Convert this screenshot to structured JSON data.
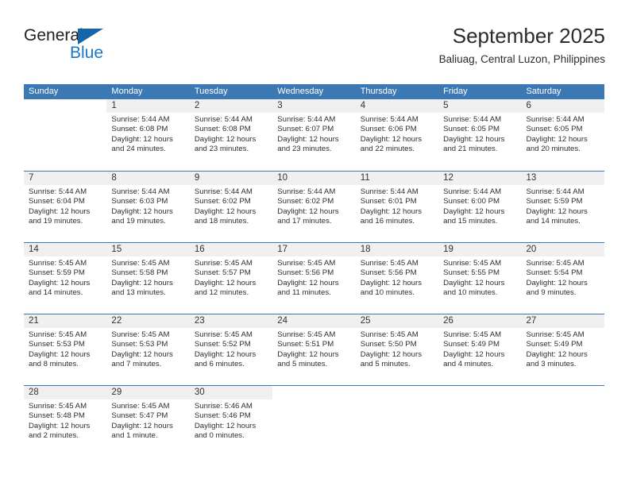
{
  "brand": {
    "name_top": "General",
    "name_bottom": "Blue",
    "triangle_icon": "triangle-icon",
    "color_dark": "#231f20",
    "color_blue": "#1878c8"
  },
  "header": {
    "title": "September 2025",
    "subtitle": "Baliuag, Central Luzon, Philippines"
  },
  "theme": {
    "header_bar": "#3c78b4",
    "daynum_band": "#f0f0f0",
    "row_rule": "#3c78b4",
    "text": "#2e2e2e"
  },
  "weekdays": [
    "Sunday",
    "Monday",
    "Tuesday",
    "Wednesday",
    "Thursday",
    "Friday",
    "Saturday"
  ],
  "weeks": [
    [
      {
        "day": "",
        "sunrise": "",
        "sunset": "",
        "daylight_a": "",
        "daylight_b": ""
      },
      {
        "day": "1",
        "sunrise": "Sunrise: 5:44 AM",
        "sunset": "Sunset: 6:08 PM",
        "daylight_a": "Daylight: 12 hours",
        "daylight_b": "and 24 minutes."
      },
      {
        "day": "2",
        "sunrise": "Sunrise: 5:44 AM",
        "sunset": "Sunset: 6:08 PM",
        "daylight_a": "Daylight: 12 hours",
        "daylight_b": "and 23 minutes."
      },
      {
        "day": "3",
        "sunrise": "Sunrise: 5:44 AM",
        "sunset": "Sunset: 6:07 PM",
        "daylight_a": "Daylight: 12 hours",
        "daylight_b": "and 23 minutes."
      },
      {
        "day": "4",
        "sunrise": "Sunrise: 5:44 AM",
        "sunset": "Sunset: 6:06 PM",
        "daylight_a": "Daylight: 12 hours",
        "daylight_b": "and 22 minutes."
      },
      {
        "day": "5",
        "sunrise": "Sunrise: 5:44 AM",
        "sunset": "Sunset: 6:05 PM",
        "daylight_a": "Daylight: 12 hours",
        "daylight_b": "and 21 minutes."
      },
      {
        "day": "6",
        "sunrise": "Sunrise: 5:44 AM",
        "sunset": "Sunset: 6:05 PM",
        "daylight_a": "Daylight: 12 hours",
        "daylight_b": "and 20 minutes."
      }
    ],
    [
      {
        "day": "7",
        "sunrise": "Sunrise: 5:44 AM",
        "sunset": "Sunset: 6:04 PM",
        "daylight_a": "Daylight: 12 hours",
        "daylight_b": "and 19 minutes."
      },
      {
        "day": "8",
        "sunrise": "Sunrise: 5:44 AM",
        "sunset": "Sunset: 6:03 PM",
        "daylight_a": "Daylight: 12 hours",
        "daylight_b": "and 19 minutes."
      },
      {
        "day": "9",
        "sunrise": "Sunrise: 5:44 AM",
        "sunset": "Sunset: 6:02 PM",
        "daylight_a": "Daylight: 12 hours",
        "daylight_b": "and 18 minutes."
      },
      {
        "day": "10",
        "sunrise": "Sunrise: 5:44 AM",
        "sunset": "Sunset: 6:02 PM",
        "daylight_a": "Daylight: 12 hours",
        "daylight_b": "and 17 minutes."
      },
      {
        "day": "11",
        "sunrise": "Sunrise: 5:44 AM",
        "sunset": "Sunset: 6:01 PM",
        "daylight_a": "Daylight: 12 hours",
        "daylight_b": "and 16 minutes."
      },
      {
        "day": "12",
        "sunrise": "Sunrise: 5:44 AM",
        "sunset": "Sunset: 6:00 PM",
        "daylight_a": "Daylight: 12 hours",
        "daylight_b": "and 15 minutes."
      },
      {
        "day": "13",
        "sunrise": "Sunrise: 5:44 AM",
        "sunset": "Sunset: 5:59 PM",
        "daylight_a": "Daylight: 12 hours",
        "daylight_b": "and 14 minutes."
      }
    ],
    [
      {
        "day": "14",
        "sunrise": "Sunrise: 5:45 AM",
        "sunset": "Sunset: 5:59 PM",
        "daylight_a": "Daylight: 12 hours",
        "daylight_b": "and 14 minutes."
      },
      {
        "day": "15",
        "sunrise": "Sunrise: 5:45 AM",
        "sunset": "Sunset: 5:58 PM",
        "daylight_a": "Daylight: 12 hours",
        "daylight_b": "and 13 minutes."
      },
      {
        "day": "16",
        "sunrise": "Sunrise: 5:45 AM",
        "sunset": "Sunset: 5:57 PM",
        "daylight_a": "Daylight: 12 hours",
        "daylight_b": "and 12 minutes."
      },
      {
        "day": "17",
        "sunrise": "Sunrise: 5:45 AM",
        "sunset": "Sunset: 5:56 PM",
        "daylight_a": "Daylight: 12 hours",
        "daylight_b": "and 11 minutes."
      },
      {
        "day": "18",
        "sunrise": "Sunrise: 5:45 AM",
        "sunset": "Sunset: 5:56 PM",
        "daylight_a": "Daylight: 12 hours",
        "daylight_b": "and 10 minutes."
      },
      {
        "day": "19",
        "sunrise": "Sunrise: 5:45 AM",
        "sunset": "Sunset: 5:55 PM",
        "daylight_a": "Daylight: 12 hours",
        "daylight_b": "and 10 minutes."
      },
      {
        "day": "20",
        "sunrise": "Sunrise: 5:45 AM",
        "sunset": "Sunset: 5:54 PM",
        "daylight_a": "Daylight: 12 hours",
        "daylight_b": "and 9 minutes."
      }
    ],
    [
      {
        "day": "21",
        "sunrise": "Sunrise: 5:45 AM",
        "sunset": "Sunset: 5:53 PM",
        "daylight_a": "Daylight: 12 hours",
        "daylight_b": "and 8 minutes."
      },
      {
        "day": "22",
        "sunrise": "Sunrise: 5:45 AM",
        "sunset": "Sunset: 5:53 PM",
        "daylight_a": "Daylight: 12 hours",
        "daylight_b": "and 7 minutes."
      },
      {
        "day": "23",
        "sunrise": "Sunrise: 5:45 AM",
        "sunset": "Sunset: 5:52 PM",
        "daylight_a": "Daylight: 12 hours",
        "daylight_b": "and 6 minutes."
      },
      {
        "day": "24",
        "sunrise": "Sunrise: 5:45 AM",
        "sunset": "Sunset: 5:51 PM",
        "daylight_a": "Daylight: 12 hours",
        "daylight_b": "and 5 minutes."
      },
      {
        "day": "25",
        "sunrise": "Sunrise: 5:45 AM",
        "sunset": "Sunset: 5:50 PM",
        "daylight_a": "Daylight: 12 hours",
        "daylight_b": "and 5 minutes."
      },
      {
        "day": "26",
        "sunrise": "Sunrise: 5:45 AM",
        "sunset": "Sunset: 5:49 PM",
        "daylight_a": "Daylight: 12 hours",
        "daylight_b": "and 4 minutes."
      },
      {
        "day": "27",
        "sunrise": "Sunrise: 5:45 AM",
        "sunset": "Sunset: 5:49 PM",
        "daylight_a": "Daylight: 12 hours",
        "daylight_b": "and 3 minutes."
      }
    ],
    [
      {
        "day": "28",
        "sunrise": "Sunrise: 5:45 AM",
        "sunset": "Sunset: 5:48 PM",
        "daylight_a": "Daylight: 12 hours",
        "daylight_b": "and 2 minutes."
      },
      {
        "day": "29",
        "sunrise": "Sunrise: 5:45 AM",
        "sunset": "Sunset: 5:47 PM",
        "daylight_a": "Daylight: 12 hours",
        "daylight_b": "and 1 minute."
      },
      {
        "day": "30",
        "sunrise": "Sunrise: 5:46 AM",
        "sunset": "Sunset: 5:46 PM",
        "daylight_a": "Daylight: 12 hours",
        "daylight_b": "and 0 minutes."
      },
      {
        "day": "",
        "sunrise": "",
        "sunset": "",
        "daylight_a": "",
        "daylight_b": ""
      },
      {
        "day": "",
        "sunrise": "",
        "sunset": "",
        "daylight_a": "",
        "daylight_b": ""
      },
      {
        "day": "",
        "sunrise": "",
        "sunset": "",
        "daylight_a": "",
        "daylight_b": ""
      },
      {
        "day": "",
        "sunrise": "",
        "sunset": "",
        "daylight_a": "",
        "daylight_b": ""
      }
    ]
  ]
}
